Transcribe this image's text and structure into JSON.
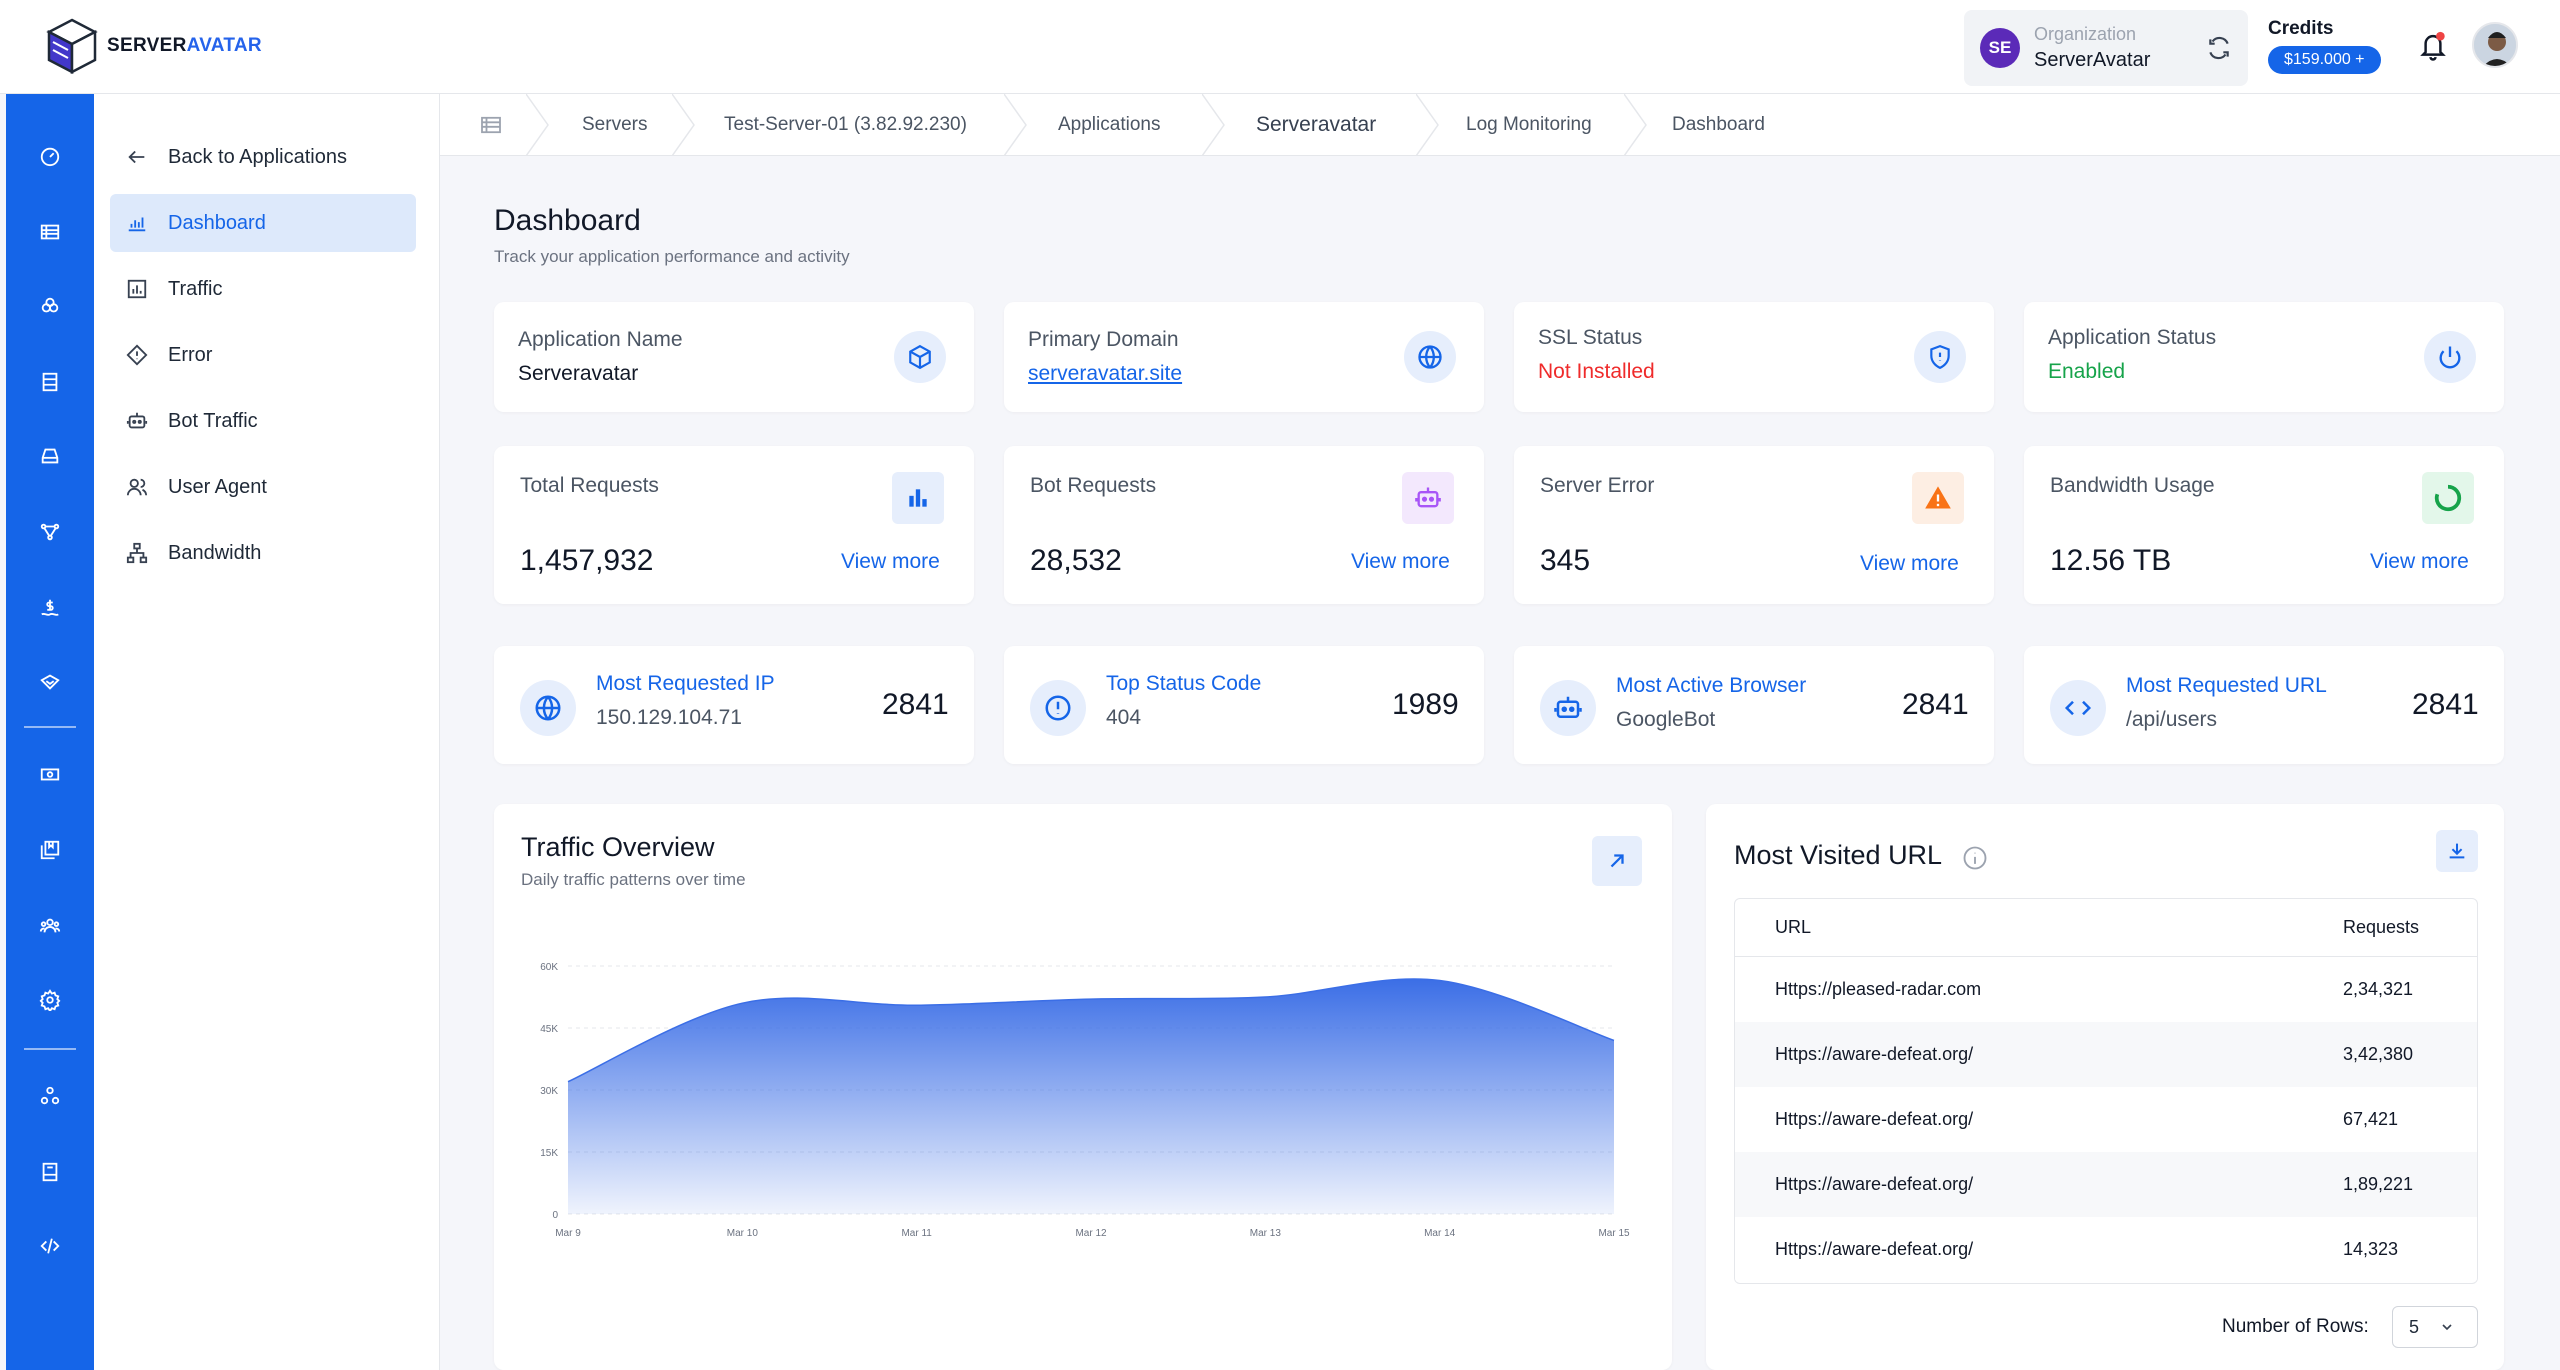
{
  "brand": {
    "name_main": "SERVER",
    "name_accent": "AVATAR"
  },
  "header": {
    "org_initials": "SE",
    "org_label": "Organization",
    "org_name": "ServerAvatar",
    "credits_label": "Credits",
    "credits_value": "$159.000  +"
  },
  "rail": {
    "icons": [
      "dashboard-icon",
      "servers-icon",
      "cloud-icon",
      "list-icon",
      "storage-icon",
      "workflow-icon",
      "billing-icon",
      "shield-icon",
      "cash-icon",
      "books-icon",
      "team-icon",
      "settings-icon",
      "integrations-icon",
      "docs-icon",
      "code-icon"
    ]
  },
  "sidebar": {
    "back_label": "Back to Applications",
    "items": [
      {
        "label": "Dashboard",
        "icon": "chart-icon"
      },
      {
        "label": "Traffic",
        "icon": "bar-chart-icon"
      },
      {
        "label": "Error",
        "icon": "diamond-alert-icon"
      },
      {
        "label": "Bot Traffic",
        "icon": "robot-icon"
      },
      {
        "label": "User Agent",
        "icon": "users-icon"
      },
      {
        "label": "Bandwidth",
        "icon": "network-icon"
      }
    ]
  },
  "breadcrumb": [
    "Servers",
    "Test-Server-01 (3.82.92.230)",
    "Applications",
    "Serveravatar",
    "Log Monitoring",
    "Dashboard"
  ],
  "page": {
    "title": "Dashboard",
    "subtitle": "Track your application performance and activity"
  },
  "info_cards": [
    {
      "label": "Application Name",
      "value": "Serveravatar",
      "icon": "cube-icon"
    },
    {
      "label": "Primary Domain",
      "value": "serveravatar.site",
      "icon": "globe-icon"
    },
    {
      "label": "SSL Status",
      "value": "Not Installed",
      "icon": "shield-icon",
      "color": "#ef2b2b"
    },
    {
      "label": "Application Status",
      "value": "Enabled",
      "icon": "power-icon",
      "color": "#16a34a"
    }
  ],
  "stat_cards": [
    {
      "label": "Total Requests",
      "value": "1,457,932",
      "link": "View more",
      "icon": "bar-chart-icon"
    },
    {
      "label": "Bot Requests",
      "value": "28,532",
      "link": "View more",
      "icon": "robot-icon"
    },
    {
      "label": "Server Error",
      "value": "345",
      "link": "View more",
      "icon": "warning-icon"
    },
    {
      "label": "Bandwidth Usage",
      "value": "12.56 TB",
      "link": "View more",
      "icon": "progress-ring-icon"
    }
  ],
  "top_cards": [
    {
      "label": "Most Requested IP",
      "sub": "150.129.104.71",
      "value": "2841",
      "icon": "globe-icon"
    },
    {
      "label": "Top Status Code",
      "sub": "404",
      "value": "1989",
      "icon": "alert-circle-icon"
    },
    {
      "label": "Most Active Browser",
      "sub": "GoogleBot",
      "value": "2841",
      "icon": "robot-icon"
    },
    {
      "label": "Most Requested URL",
      "sub": "/api/users",
      "value": "2841",
      "icon": "code-icon"
    }
  ],
  "traffic": {
    "title": "Traffic Overview",
    "subtitle": "Daily traffic patterns over time"
  },
  "chart_data": {
    "type": "area",
    "title": "Traffic Overview",
    "x": [
      "Mar 9",
      "Mar 10",
      "Mar 11",
      "Mar 12",
      "Mar 13",
      "Mar 14",
      "Mar 15"
    ],
    "values": [
      32000,
      51000,
      50500,
      52000,
      52500,
      56500,
      42000
    ],
    "yticks": [
      "60K",
      "45K",
      "30K",
      "15K",
      "0"
    ],
    "ylim": [
      0,
      60000
    ],
    "grid": true,
    "color": "#3b6ee6"
  },
  "urls": {
    "title": "Most Visited URL",
    "col_url": "URL",
    "col_req": "Requests",
    "rows": [
      {
        "url": "Https://pleased-radar.com",
        "requests": "2,34,321"
      },
      {
        "url": "Https://aware-defeat.org/",
        "requests": "3,42,380"
      },
      {
        "url": "Https://aware-defeat.org/",
        "requests": "67,421"
      },
      {
        "url": "Https://aware-defeat.org/",
        "requests": "1,89,221"
      },
      {
        "url": "Https://aware-defeat.org/",
        "requests": "14,323"
      }
    ],
    "rows_label": "Number of Rows:",
    "rows_value": "5"
  }
}
